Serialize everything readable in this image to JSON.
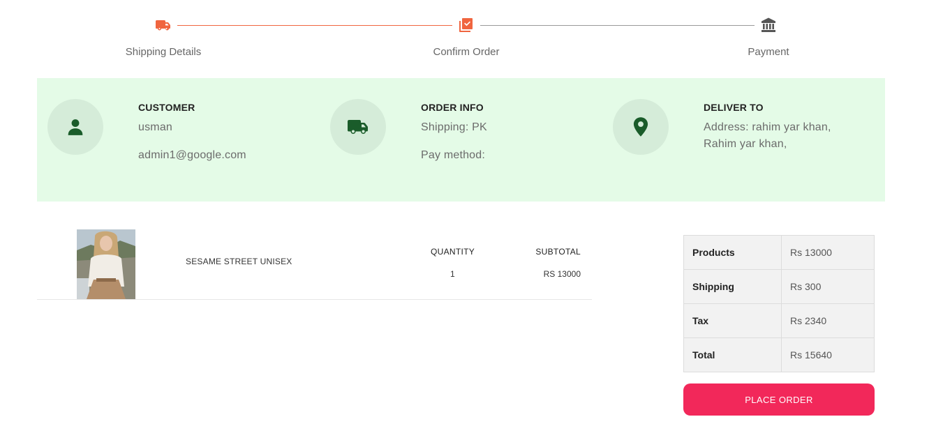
{
  "stepper": {
    "steps": [
      {
        "label": "Shipping Details",
        "icon": "truck-icon",
        "state": "done"
      },
      {
        "label": "Confirm Order",
        "icon": "checklist-icon",
        "state": "active"
      },
      {
        "label": "Payment",
        "icon": "bank-icon",
        "state": "pending"
      }
    ],
    "colors": {
      "active": "#f0653f",
      "pending": "#555555",
      "line_done": "#f0653f",
      "line_pending": "#999999"
    }
  },
  "info": {
    "band_color": "#e4fbe7",
    "icon_color": "#1a5c2a",
    "customer": {
      "title": "CUSTOMER",
      "name": "usman",
      "email": "admin1@google.com",
      "icon": "user-icon"
    },
    "order": {
      "title": "ORDER INFO",
      "shipping": "Shipping: PK",
      "pay_method": "Pay method:",
      "icon": "truck-icon"
    },
    "deliver": {
      "title": "DELIVER TO",
      "address_line1": "Address: rahim yar khan,",
      "address_line2": "Rahim yar khan,",
      "icon": "map-pin-icon"
    }
  },
  "cart": {
    "items": [
      {
        "name": "SESAME STREET UNISEX",
        "quantity_label": "QUANTITY",
        "quantity": "1",
        "subtotal_label": "SUBTOTAL",
        "subtotal": "RS 13000"
      }
    ]
  },
  "summary": {
    "rows": [
      {
        "label": "Products",
        "value": "Rs 13000"
      },
      {
        "label": "Shipping",
        "value": "Rs 300"
      },
      {
        "label": "Tax",
        "value": "Rs 2340"
      },
      {
        "label": "Total",
        "value": "Rs 15640"
      }
    ],
    "button_label": "PLACE ORDER",
    "button_color": "#f2285a"
  }
}
